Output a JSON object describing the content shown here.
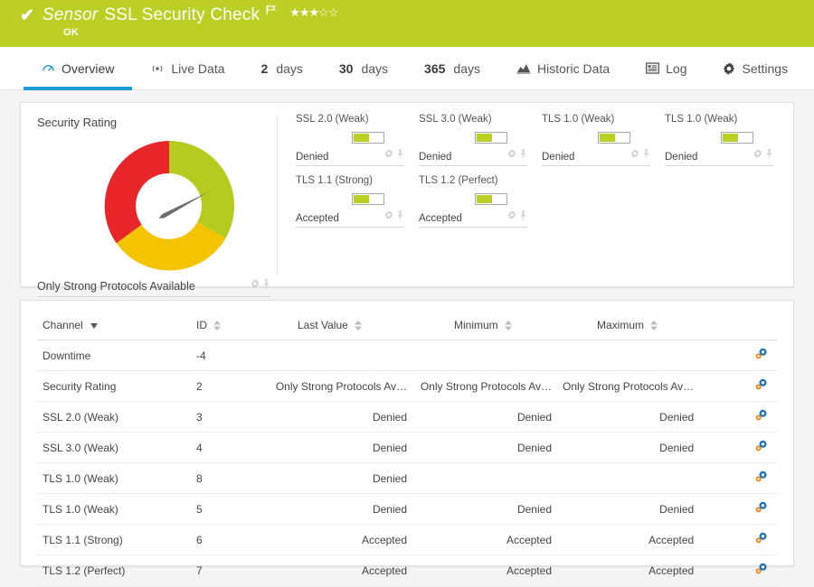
{
  "header": {
    "check_icon": "check-icon",
    "sensor_word": "Sensor",
    "sensor_name": "SSL Security Check",
    "flag_icon": "flag-icon",
    "rating_filled": 3,
    "rating_total": 5,
    "status": "OK",
    "background_color": "#bccf24"
  },
  "tabs": [
    {
      "label": "Overview",
      "icon": "gauge-icon",
      "active": true
    },
    {
      "label": "Live Data",
      "icon": "live-data-icon",
      "active": false
    },
    {
      "number": "2",
      "label": "days",
      "active": false
    },
    {
      "number": "30",
      "label": "days",
      "active": false
    },
    {
      "number": "365",
      "label": "days",
      "active": false
    },
    {
      "label": "Historic Data",
      "icon": "histogram-icon",
      "active": false
    },
    {
      "label": "Log",
      "icon": "log-icon",
      "active": false
    },
    {
      "label": "Settings",
      "icon": "gear-icon",
      "active": false
    }
  ],
  "accent_color": "#1f9dd9",
  "gauge": {
    "title": "Security Rating",
    "value_label": "Only Strong Protocols Available",
    "segments": [
      {
        "name": "good",
        "color": "#b5cc1e"
      },
      {
        "name": "warning",
        "color": "#f5c400"
      },
      {
        "name": "critical",
        "color": "#e8262a"
      }
    ],
    "needle_color": "#6d6d6d",
    "needle_angle_deg": 62
  },
  "channel_cards": [
    {
      "title": "SSL 2.0 (Weak)",
      "value": "Denied",
      "bar_percent": 50
    },
    {
      "title": "SSL 3.0 (Weak)",
      "value": "Denied",
      "bar_percent": 50
    },
    {
      "title": "TLS 1.0 (Weak)",
      "value": "Denied",
      "bar_percent": 50
    },
    {
      "title": "TLS 1.0 (Weak)",
      "value": "Denied",
      "bar_percent": 50
    },
    {
      "title": "TLS 1.1 (Strong)",
      "value": "Accepted",
      "bar_percent": 50
    },
    {
      "title": "TLS 1.2 (Perfect)",
      "value": "Accepted",
      "bar_percent": 50
    }
  ],
  "table": {
    "columns": [
      "Channel",
      "ID",
      "Last Value",
      "Minimum",
      "Maximum"
    ],
    "sorted_by": "Channel",
    "rows": [
      {
        "channel": "Downtime",
        "id": "-4",
        "last": "",
        "min": "",
        "max": ""
      },
      {
        "channel": "Security Rating",
        "id": "2",
        "last": "Only Strong Protocols Av…",
        "min": "Only Strong Protocols Av…",
        "max": "Only Strong Protocols Av…"
      },
      {
        "channel": "SSL 2.0 (Weak)",
        "id": "3",
        "last": "Denied",
        "min": "Denied",
        "max": "Denied"
      },
      {
        "channel": "SSL 3.0 (Weak)",
        "id": "4",
        "last": "Denied",
        "min": "Denied",
        "max": "Denied"
      },
      {
        "channel": "TLS 1.0 (Weak)",
        "id": "8",
        "last": "Denied",
        "min": "",
        "max": ""
      },
      {
        "channel": "TLS 1.0 (Weak)",
        "id": "5",
        "last": "Denied",
        "min": "Denied",
        "max": "Denied"
      },
      {
        "channel": "TLS 1.1 (Strong)",
        "id": "6",
        "last": "Accepted",
        "min": "Accepted",
        "max": "Accepted"
      },
      {
        "channel": "TLS 1.2 (Perfect)",
        "id": "7",
        "last": "Accepted",
        "min": "Accepted",
        "max": "Accepted"
      }
    ],
    "row_action_icon": "channel-settings-icon"
  }
}
